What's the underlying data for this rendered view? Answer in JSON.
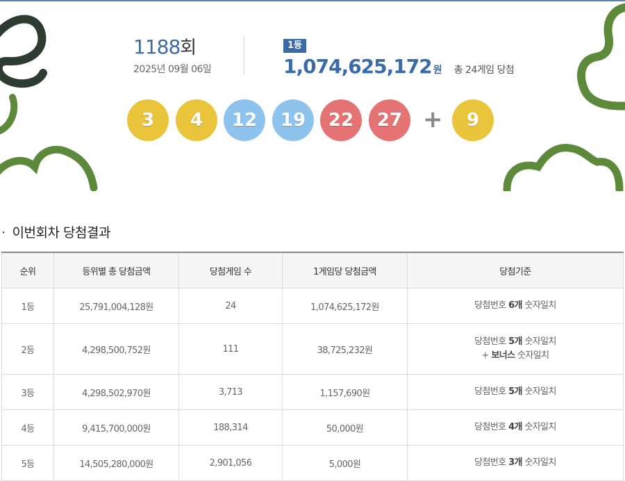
{
  "draw": {
    "round_number": "1188",
    "round_suffix": "회",
    "date": "2025년 09월 06일"
  },
  "first_prize": {
    "badge": "1등",
    "amount": "1,074,625,172",
    "currency": "원",
    "winners_note": "총 24게임 당첨"
  },
  "numbers": {
    "main": [
      {
        "value": "3",
        "color": "yellow"
      },
      {
        "value": "4",
        "color": "yellow"
      },
      {
        "value": "12",
        "color": "blue"
      },
      {
        "value": "19",
        "color": "blue"
      },
      {
        "value": "22",
        "color": "red"
      },
      {
        "value": "27",
        "color": "red"
      }
    ],
    "plus": "+",
    "bonus": {
      "value": "9",
      "color": "yellow"
    }
  },
  "colors": {
    "accent": "#3c6aa6",
    "ball_yellow": "#eac43a",
    "ball_blue": "#8ec3ed",
    "ball_red": "#e67373",
    "decor_green": "#5d8a3a",
    "decor_dark": "#2c3c31"
  },
  "results": {
    "section_title": "이번회차 당첨결과",
    "headers": [
      "순위",
      "등위별 총 당첨금액",
      "당첨게임 수",
      "1게임당 당첨금액",
      "당첨기준"
    ],
    "rows": [
      {
        "rank": "1등",
        "total": "25,791,004,128원",
        "games": "24",
        "per_game": "1,074,625,172원",
        "crit_pre": "당첨번호 ",
        "crit_bold": "6개",
        "crit_post": " 숫자일치",
        "crit2_pre": "",
        "crit2_bold": "",
        "crit2_post": ""
      },
      {
        "rank": "2등",
        "total": "4,298,500,752원",
        "games": "111",
        "per_game": "38,725,232원",
        "crit_pre": "당첨번호 ",
        "crit_bold": "5개",
        "crit_post": " 숫자일치",
        "crit2_pre": "+ ",
        "crit2_bold": "보너스",
        "crit2_post": " 숫자일치"
      },
      {
        "rank": "3등",
        "total": "4,298,502,970원",
        "games": "3,713",
        "per_game": "1,157,690원",
        "crit_pre": "당첨번호 ",
        "crit_bold": "5개",
        "crit_post": " 숫자일치",
        "crit2_pre": "",
        "crit2_bold": "",
        "crit2_post": ""
      },
      {
        "rank": "4등",
        "total": "9,415,700,000원",
        "games": "188,314",
        "per_game": "50,000원",
        "crit_pre": "당첨번호 ",
        "crit_bold": "4개",
        "crit_post": " 숫자일치",
        "crit2_pre": "",
        "crit2_bold": "",
        "crit2_post": ""
      },
      {
        "rank": "5등",
        "total": "14,505,280,000원",
        "games": "2,901,056",
        "per_game": "5,000원",
        "crit_pre": "당첨번호 ",
        "crit_bold": "3개",
        "crit_post": " 숫자일치",
        "crit2_pre": "",
        "crit2_bold": "",
        "crit2_post": ""
      }
    ]
  }
}
